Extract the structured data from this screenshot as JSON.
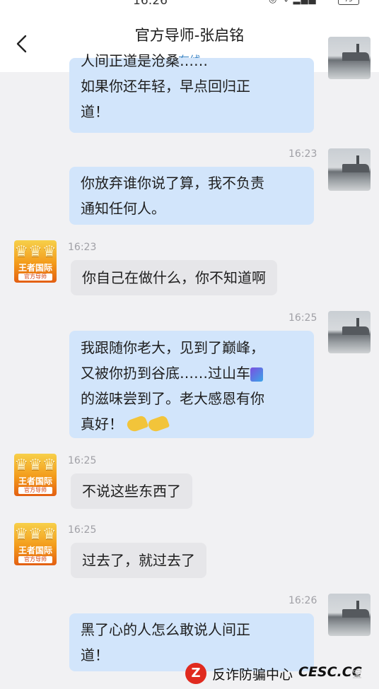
{
  "status_bar": {
    "time": "16:26",
    "battery": "79"
  },
  "header": {
    "title": "官方导师-张启铭",
    "status": "在线"
  },
  "messages": [
    {
      "id": "m0",
      "side": "out",
      "text_line1": "人间正道是沧桑……",
      "text_line2": "如果你还年轻，早点回归正",
      "text_line3": "道！"
    },
    {
      "id": "m1",
      "side": "out",
      "time": "16:23",
      "text_line1": "你放弃谁你说了算，我不负责",
      "text_line2": "通知任何人。"
    },
    {
      "id": "m2",
      "side": "in",
      "time": "16:23",
      "text": "你自己在做什么，你不知道啊"
    },
    {
      "id": "m3",
      "side": "out",
      "time": "16:25",
      "text_line1": "我跟随你老大，见到了巅峰，",
      "text_line2": "又被你扔到谷底……过山车",
      "text_line3": "的滋味尝到了。老大感恩有你",
      "text_line4": "真好！"
    },
    {
      "id": "m4",
      "side": "in",
      "time": "16:25",
      "text": "不说这些东西了"
    },
    {
      "id": "m5",
      "side": "in",
      "time": "16:25",
      "text": "过去了，就过去了"
    },
    {
      "id": "m6",
      "side": "out",
      "time": "16:26",
      "text_line1": "黑了心的人怎么敢说人间正",
      "text_line2": "道！"
    }
  ],
  "mentor_avatar": {
    "brand": "王者国际",
    "sub": "官方导师"
  },
  "watermark": {
    "text": "反诈防骗中心",
    "domain": "CESC.CC",
    "faded": "宝"
  },
  "icons": [
    "back-arrow-icon",
    "more-dots-icon",
    "roller-coaster-emoji",
    "praying-hands-emoji"
  ]
}
